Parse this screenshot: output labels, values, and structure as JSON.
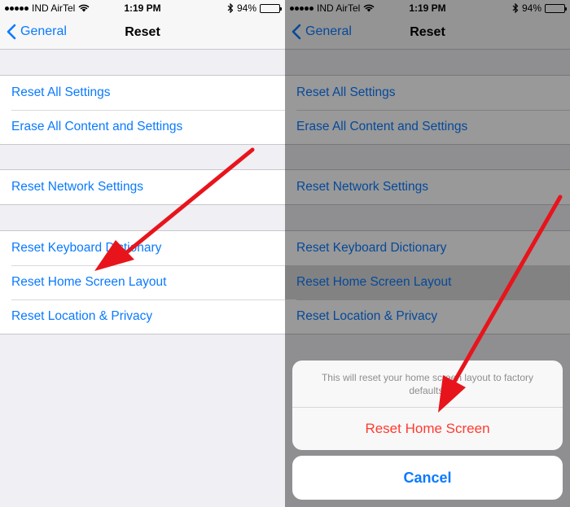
{
  "status": {
    "carrier": "IND AirTel",
    "time": "1:19 PM",
    "battery": "94%",
    "battery_level": 0.94
  },
  "nav": {
    "back_label": "General",
    "title": "Reset"
  },
  "groups": {
    "g1": [
      "Reset All Settings",
      "Erase All Content and Settings"
    ],
    "g2": [
      "Reset Network Settings"
    ],
    "g3": [
      "Reset Keyboard Dictionary",
      "Reset Home Screen Layout",
      "Reset Location & Privacy"
    ]
  },
  "sheet": {
    "message": "This will reset your home screen layout to factory defaults.",
    "action_label": "Reset Home Screen",
    "cancel_label": "Cancel"
  },
  "colors": {
    "ios_blue": "#0a7aff",
    "destructive_red": "#ff3b30",
    "arrow_red": "#e8141c"
  },
  "icons": [
    "signal-dots-icon",
    "wifi-icon",
    "bluetooth-icon",
    "battery-icon",
    "chevron-left-icon",
    "annotation-arrow"
  ]
}
